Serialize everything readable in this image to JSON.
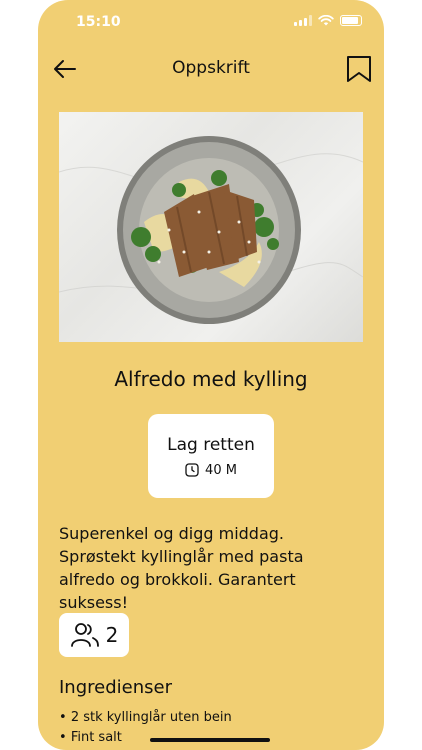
{
  "status": {
    "time": "15:10"
  },
  "nav": {
    "title": "Oppskrift"
  },
  "recipe": {
    "title": "Alfredo med kylling",
    "cook_button": {
      "label": "Lag retten",
      "time": "40 M"
    },
    "description": "Superenkel og digg middag. Sprøstekt kyllinglår med pasta alfredo og brokkoli. Garantert suksess!",
    "servings": "2",
    "ingredients_heading": "Ingredienser",
    "ingredients": [
      "2 stk kyllinglår uten bein",
      "Fint salt"
    ]
  },
  "colors": {
    "background": "#F1CF73",
    "card": "#FFFFFF",
    "text": "#111111"
  },
  "icons": [
    "back-arrow-icon",
    "bookmark-icon",
    "clock-icon",
    "people-icon"
  ]
}
